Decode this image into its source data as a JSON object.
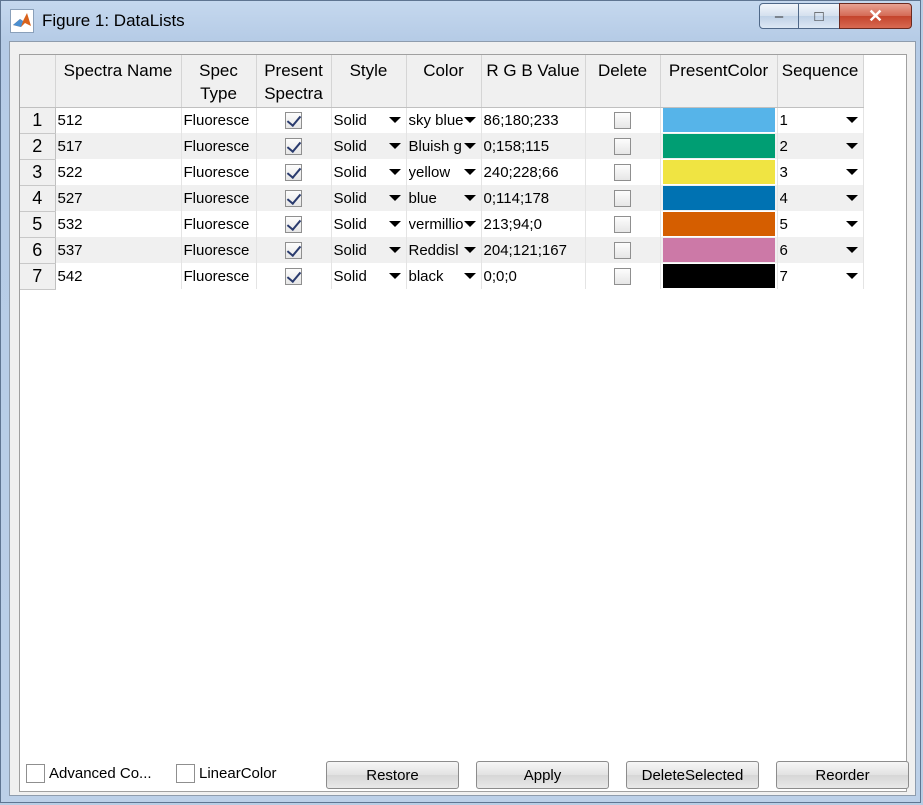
{
  "window": {
    "title": "Figure 1: DataLists",
    "controls": {
      "minimize": "–",
      "maximize": "□",
      "close": "✕"
    }
  },
  "table": {
    "columns": [
      "Spectra Name",
      "Spec Type",
      "Present Spectra",
      "Style",
      "Color",
      "R G B Value",
      "Delete",
      "PresentColor",
      "Sequence"
    ],
    "rows": [
      {
        "num": "1",
        "name": "512",
        "type": "Fluoresce",
        "present": true,
        "style": "Solid",
        "color": "sky blue",
        "rgb": "86;180;233",
        "delete": false,
        "swatch": "#56b4e9",
        "seq": "1"
      },
      {
        "num": "2",
        "name": "517",
        "type": "Fluoresce",
        "present": true,
        "style": "Solid",
        "color": "Bluish g",
        "rgb": "0;158;115",
        "delete": false,
        "swatch": "#009e73",
        "seq": "2"
      },
      {
        "num": "3",
        "name": "522",
        "type": "Fluoresce",
        "present": true,
        "style": "Solid",
        "color": "yellow",
        "rgb": "240;228;66",
        "delete": false,
        "swatch": "#f0e442",
        "seq": "3"
      },
      {
        "num": "4",
        "name": "527",
        "type": "Fluoresce",
        "present": true,
        "style": "Solid",
        "color": "blue",
        "rgb": "0;114;178",
        "delete": false,
        "swatch": "#0072b2",
        "seq": "4"
      },
      {
        "num": "5",
        "name": "532",
        "type": "Fluoresce",
        "present": true,
        "style": "Solid",
        "color": "vermillio",
        "rgb": "213;94;0",
        "delete": false,
        "swatch": "#d55e00",
        "seq": "5"
      },
      {
        "num": "6",
        "name": "537",
        "type": "Fluoresce",
        "present": true,
        "style": "Solid",
        "color": "Reddisl",
        "rgb": "204;121;167",
        "delete": false,
        "swatch": "#cc79a7",
        "seq": "6"
      },
      {
        "num": "7",
        "name": "542",
        "type": "Fluoresce",
        "present": true,
        "style": "Solid",
        "color": "black",
        "rgb": "0;0;0",
        "delete": false,
        "swatch": "#000000",
        "seq": "7"
      }
    ]
  },
  "bottom": {
    "advanced_label": "Advanced Co...",
    "linear_label": "LinearColor",
    "restore": "Restore",
    "apply": "Apply",
    "delete_selected": "DeleteSelected",
    "reorder": "Reorder"
  }
}
